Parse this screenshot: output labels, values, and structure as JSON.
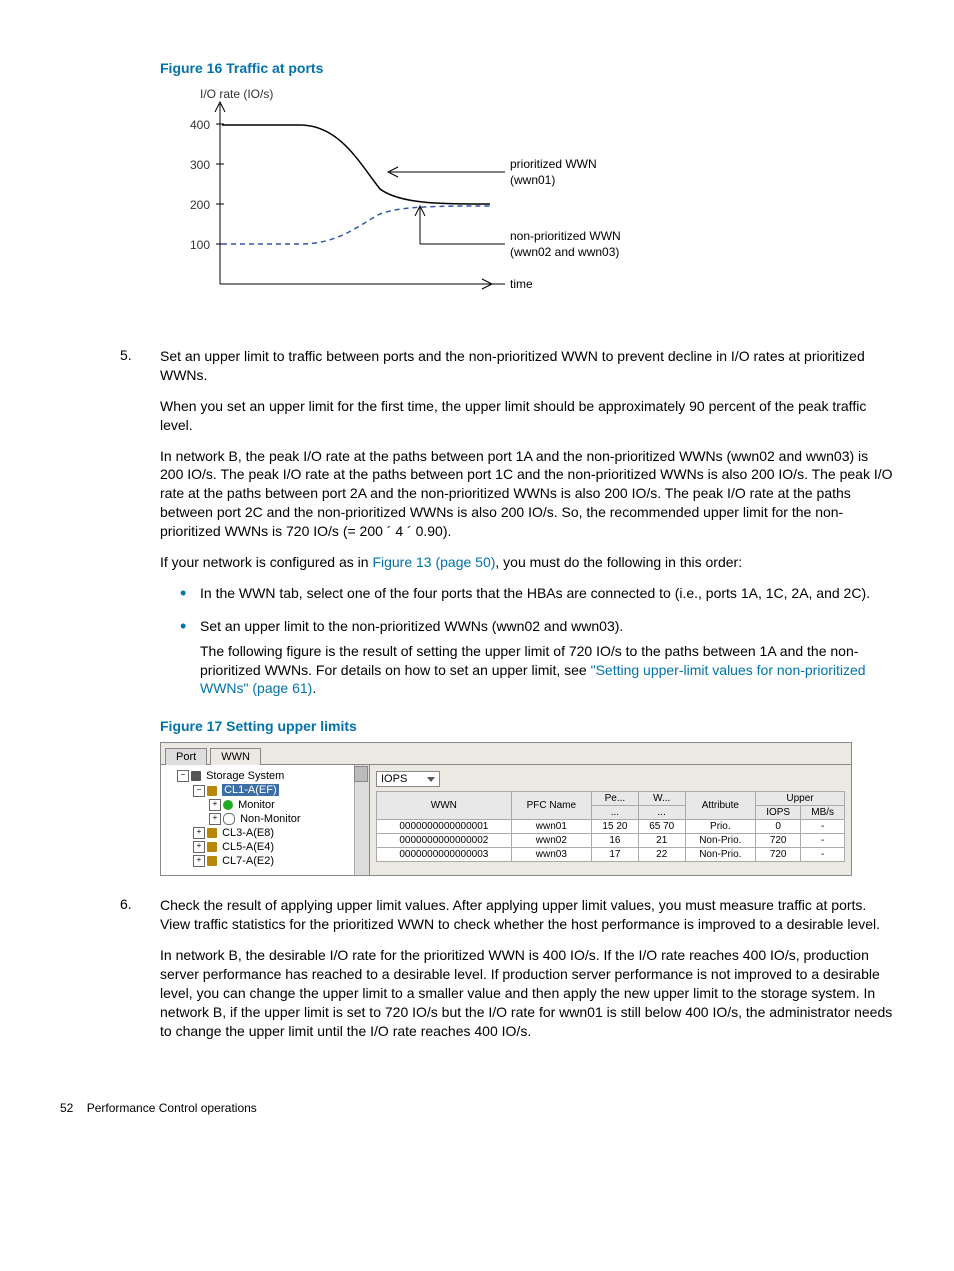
{
  "fig16_caption": "Figure 16 Traffic at ports",
  "chart_data": {
    "type": "line",
    "title": "",
    "xlabel": "time",
    "ylabel": "I/O rate (IO/s)",
    "x": [
      0,
      1,
      2,
      3,
      4,
      5,
      6,
      7,
      8,
      9,
      10
    ],
    "ylim": [
      0,
      400
    ],
    "y_ticks": [
      100,
      200,
      300,
      400
    ],
    "series": [
      {
        "name": "prioritized WWN (wwn01)",
        "values": [
          400,
          400,
          400,
          395,
          370,
          300,
          240,
          215,
          205,
          200,
          200
        ],
        "style": "solid",
        "color": "#000000"
      },
      {
        "name": "non-prioritized WWN (wwn02 and wwn03)",
        "values": [
          100,
          100,
          102,
          110,
          130,
          165,
          185,
          195,
          200,
          200,
          200
        ],
        "style": "dashed",
        "color": "#3355aa"
      }
    ],
    "annotations": [
      {
        "text": "prioritized WWN",
        "sub": "(wwn01)",
        "target_series": 0
      },
      {
        "text": "non-prioritized WWN",
        "sub": "(wwn02 and wwn03)",
        "target_series": 1
      },
      {
        "text": "time",
        "axis": "x"
      }
    ]
  },
  "step5": {
    "num": "5.",
    "p1": "Set an upper limit to traffic between ports and the non-prioritized WWN to prevent decline in I/O rates at prioritized WWNs.",
    "p2": "When you set an upper limit for the first time, the upper limit should be approximately 90 percent of the peak traffic level.",
    "p3": "In network B, the peak I/O rate at the paths between port 1A and the non-prioritized WWNs (wwn02 and wwn03) is 200 IO/s. The peak I/O rate at the paths between port 1C and the non-prioritized WWNs is also 200 IO/s. The peak I/O rate at the paths between port 2A and the non-prioritized WWNs is also 200 IO/s. The peak I/O rate at the paths between port 2C and the non-prioritized WWNs is also 200 IO/s. So, the recommended upper limit for the non-prioritized WWNs is 720 IO/s (= 200 ´ 4 ´ 0.90).",
    "p4_a": "If your network is configured as in ",
    "p4_link": "Figure 13 (page 50)",
    "p4_b": ", you must do the following in this order:",
    "bullet1": "In the WWN tab, select one of the four ports that the HBAs are connected to (i.e., ports 1A, 1C, 2A, and 2C).",
    "bullet2_a": "Set an upper limit to the non-prioritized WWNs (wwn02 and wwn03).",
    "bullet2_b_a": "The following figure is the result of setting the upper limit of 720 IO/s to the paths between 1A and the non-prioritized WWNs. For details on how to set an upper limit, see ",
    "bullet2_b_link": "\"Setting upper-limit values for non-prioritized WWNs\" (page 61)",
    "bullet2_b_b": "."
  },
  "fig17_caption": "Figure 17 Setting upper limits",
  "fig17_ui": {
    "tab_port": "Port",
    "tab_wwn": "WWN",
    "tree": {
      "root": "Storage System",
      "n1": "CL1-A(EF)",
      "n1a": "Monitor",
      "n1b": "Non-Monitor",
      "n2": "CL3-A(E8)",
      "n3": "CL5-A(E4)",
      "n4": "CL7-A(E2)"
    },
    "dropdown": "IOPS",
    "headers": {
      "wwn": "WWN",
      "pfc": "PFC Name",
      "pe": "Pe...",
      "w": "W...",
      "attr": "Attribute",
      "upper": "Upper",
      "iops": "IOPS",
      "mbs": "MB/s"
    },
    "rows": [
      {
        "wwn": "0000000000000001",
        "pfc": "wwn01",
        "c1": "15",
        "c2": "20",
        "c3": "65",
        "c4": "70",
        "attr": "Prio.",
        "iops": "0",
        "mbs": "-"
      },
      {
        "wwn": "0000000000000002",
        "pfc": "wwn02",
        "c1": "",
        "c2": "16",
        "c3": "21",
        "c4": "",
        "attr": "Non-Prio.",
        "iops": "720",
        "mbs": "-"
      },
      {
        "wwn": "0000000000000003",
        "pfc": "wwn03",
        "c1": "",
        "c2": "17",
        "c3": "22",
        "c4": "",
        "attr": "Non-Prio.",
        "iops": "720",
        "mbs": "-"
      }
    ]
  },
  "step6": {
    "num": "6.",
    "p1": "Check the result of applying upper limit values. After applying upper limit values, you must measure traffic at ports. View traffic statistics for the prioritized WWN to check whether the host performance is improved to a desirable level.",
    "p2": "In network B, the desirable I/O rate for the prioritized WWN is 400 IO/s. If the I/O rate reaches 400 IO/s, production server performance has reached to a desirable level. If production server performance is not improved to a desirable level, you can change the upper limit to a smaller value and then apply the new upper limit to the storage system. In network B, if the upper limit is set to 720 IO/s but the I/O rate for wwn01 is still below 400 IO/s, the administrator needs to change the upper limit until the I/O rate reaches 400 IO/s."
  },
  "footer": {
    "page": "52",
    "title": "Performance Control operations"
  }
}
